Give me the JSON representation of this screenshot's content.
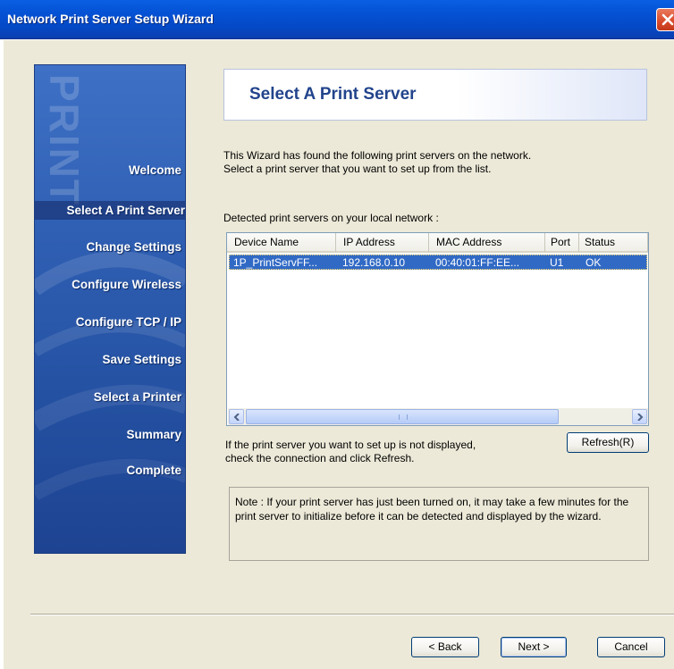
{
  "window": {
    "title": "Network Print Server Setup Wizard"
  },
  "sidebar": {
    "watermark": "PRINT",
    "steps": [
      {
        "label": "Welcome"
      },
      {
        "label": "Select A Print Server",
        "active": true
      },
      {
        "label": "Change Settings"
      },
      {
        "label": "Configure Wireless"
      },
      {
        "label": "Configure TCP / IP"
      },
      {
        "label": "Save Settings"
      },
      {
        "label": "Select a Printer"
      },
      {
        "label": "Summary"
      },
      {
        "label": "Complete"
      }
    ]
  },
  "page": {
    "title": "Select A Print Server",
    "intro_line1": "This Wizard has found the following print servers on the network.",
    "intro_line2": "Select a print server that you want to set up from the list.",
    "list_label": "Detected print servers on your local network :"
  },
  "table": {
    "columns": [
      "Device Name",
      "IP Address",
      "MAC Address",
      "Port",
      "Status"
    ],
    "rows": [
      [
        "1P_PrintServFF...",
        "192.168.0.10",
        "00:40:01:FF:EE...",
        "U1",
        "OK"
      ]
    ]
  },
  "refresh": {
    "hint_line1": "If the print server you want to set up is not displayed,",
    "hint_line2": "check the connection and click Refresh.",
    "button": "Refresh(R)"
  },
  "note": {
    "text": "Note : If your print server has just been turned on, it may take a few minutes for the print server to initialize before it can be detected and displayed by the wizard."
  },
  "footer": {
    "back": "< Back",
    "next": "Next >",
    "cancel": "Cancel"
  },
  "colors": {
    "titlebar": "#0553d6",
    "selection": "#316ac5",
    "sidebar": "#2f5fb3",
    "header_title": "#22448c",
    "dialog_bg": "#ece9d8"
  }
}
